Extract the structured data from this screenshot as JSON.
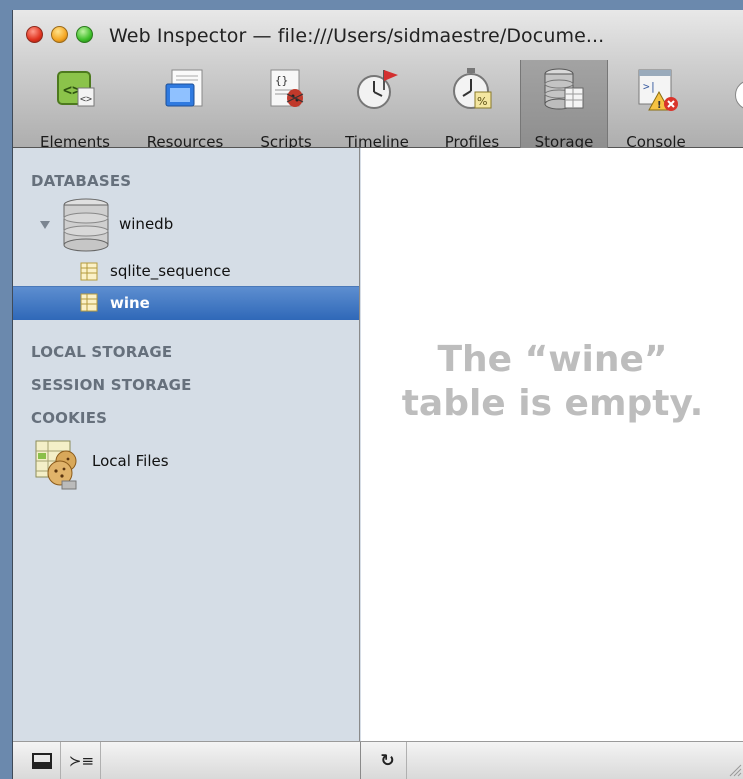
{
  "window": {
    "title": "Web Inspector — file:///Users/sidmaestre/Docume..."
  },
  "toolbar": {
    "items": [
      {
        "label": "Elements",
        "icon": "elements-icon"
      },
      {
        "label": "Resources",
        "icon": "resources-icon"
      },
      {
        "label": "Scripts",
        "icon": "scripts-icon"
      },
      {
        "label": "Timeline",
        "icon": "timeline-icon"
      },
      {
        "label": "Profiles",
        "icon": "profiles-icon"
      },
      {
        "label": "Storage",
        "icon": "storage-icon",
        "active": true
      },
      {
        "label": "Console",
        "icon": "console-icon"
      }
    ]
  },
  "sidebar": {
    "databases_header": "DATABASES",
    "database": {
      "name": "winedb",
      "icon": "database-icon"
    },
    "tables": [
      {
        "name": "sqlite_sequence",
        "icon": "table-icon"
      },
      {
        "name": "wine",
        "icon": "table-icon",
        "selected": true
      }
    ],
    "local_storage_header": "LOCAL STORAGE",
    "session_storage_header": "SESSION STORAGE",
    "cookies_header": "COOKIES",
    "cookie_item": {
      "name": "Local Files",
      "icon": "cookies-icon"
    }
  },
  "main": {
    "empty_line1": "The “wine”",
    "empty_line2": "table is empty."
  },
  "statusbar": {
    "dock_icon": "dock-window-icon",
    "console_icon": "console-prompt-icon",
    "refresh_icon": "refresh-icon",
    "console_glyph": "≻≡",
    "refresh_glyph": "↻"
  },
  "colors": {
    "selection": "#3a72c2",
    "sidebar_bg": "#d5dde6",
    "section_header": "#66707c",
    "empty_text": "#bdbdbd"
  }
}
